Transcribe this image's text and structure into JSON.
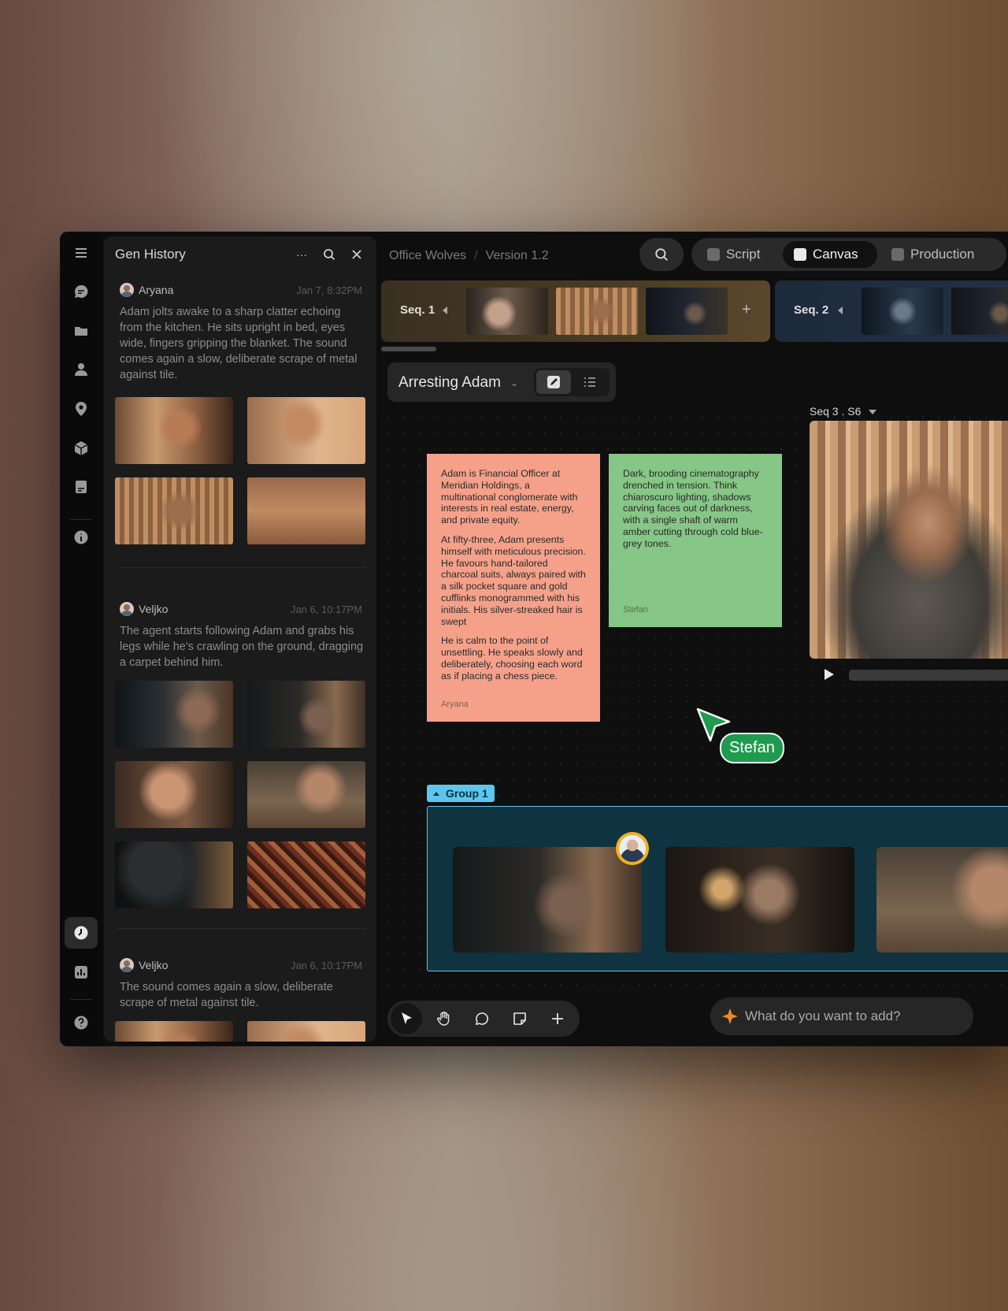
{
  "window": {
    "breadcrumb": {
      "project": "Office Wolves",
      "version": "Version 1.2"
    },
    "modes": [
      {
        "label": "Script",
        "icon": "document-icon",
        "active": false
      },
      {
        "label": "Canvas",
        "icon": "edit-icon",
        "active": true
      },
      {
        "label": "Production",
        "icon": "clapper-icon",
        "active": false
      }
    ]
  },
  "rail": {
    "icons": [
      "menu-icon",
      "chat-icon",
      "folder-icon",
      "person-icon",
      "location-icon",
      "cube-icon",
      "document-icon",
      "info-icon",
      "history-icon",
      "chart-icon",
      "help-icon"
    ]
  },
  "history": {
    "title": "Gen History",
    "more_label": "···",
    "entries": [
      {
        "user": "Aryana",
        "date": "Jan 7, 8:32PM",
        "text": "Adam jolts awake to a sharp clatter echoing from the kitchen. He sits upright in bed, eyes wide, fingers gripping the blanket. The sound comes again a slow, deliberate scrape of metal against tile."
      },
      {
        "user": "Veljko",
        "date": "Jan 6, 10:17PM",
        "text": "The agent starts following Adam and grabs his legs while he's crawling on the ground, dragging a carpet behind him."
      },
      {
        "user": "Veljko",
        "date": "Jan 6, 10:17PM",
        "text": "The sound comes again a slow, deliberate scrape of metal against tile."
      }
    ]
  },
  "sequences": [
    {
      "label": "Seq. 1",
      "add": "+"
    },
    {
      "label": "Seq. 2"
    }
  ],
  "scene": {
    "name": "Arresting Adam"
  },
  "canvas": {
    "notes": [
      {
        "color": "#f5a18a",
        "paragraphs": [
          "Adam is Financial Officer at Meridian Holdings, a multinational conglomerate with interests in real estate, energy, and private equity.",
          "At fifty-three, Adam presents himself with meticulous precision. He favours hand-tailored charcoal suits, always paired with a silk pocket square and gold cufflinks monogrammed with his initials. His silver-streaked hair is swept",
          "He is calm to the point of unsettling. He speaks slowly and deliberately, choosing each word as if placing a chess piece."
        ],
        "author": "Aryana"
      },
      {
        "color": "#86c686",
        "paragraphs": [
          "Dark, brooding cinematography drenched in tension. Think chiaroscuro lighting, shadows carving faces out of darkness, with a single shaft of warm amber cutting through cold blue-grey tones."
        ],
        "author": "Stefan"
      }
    ],
    "video": {
      "label": "Seq 3 . S6"
    },
    "cursor": {
      "name": "Stefan",
      "color": "#1f9a4e"
    },
    "group": {
      "label": "Group 1",
      "color": "#5cc6ee"
    }
  },
  "prompt": {
    "placeholder": "What do you want to add?"
  }
}
